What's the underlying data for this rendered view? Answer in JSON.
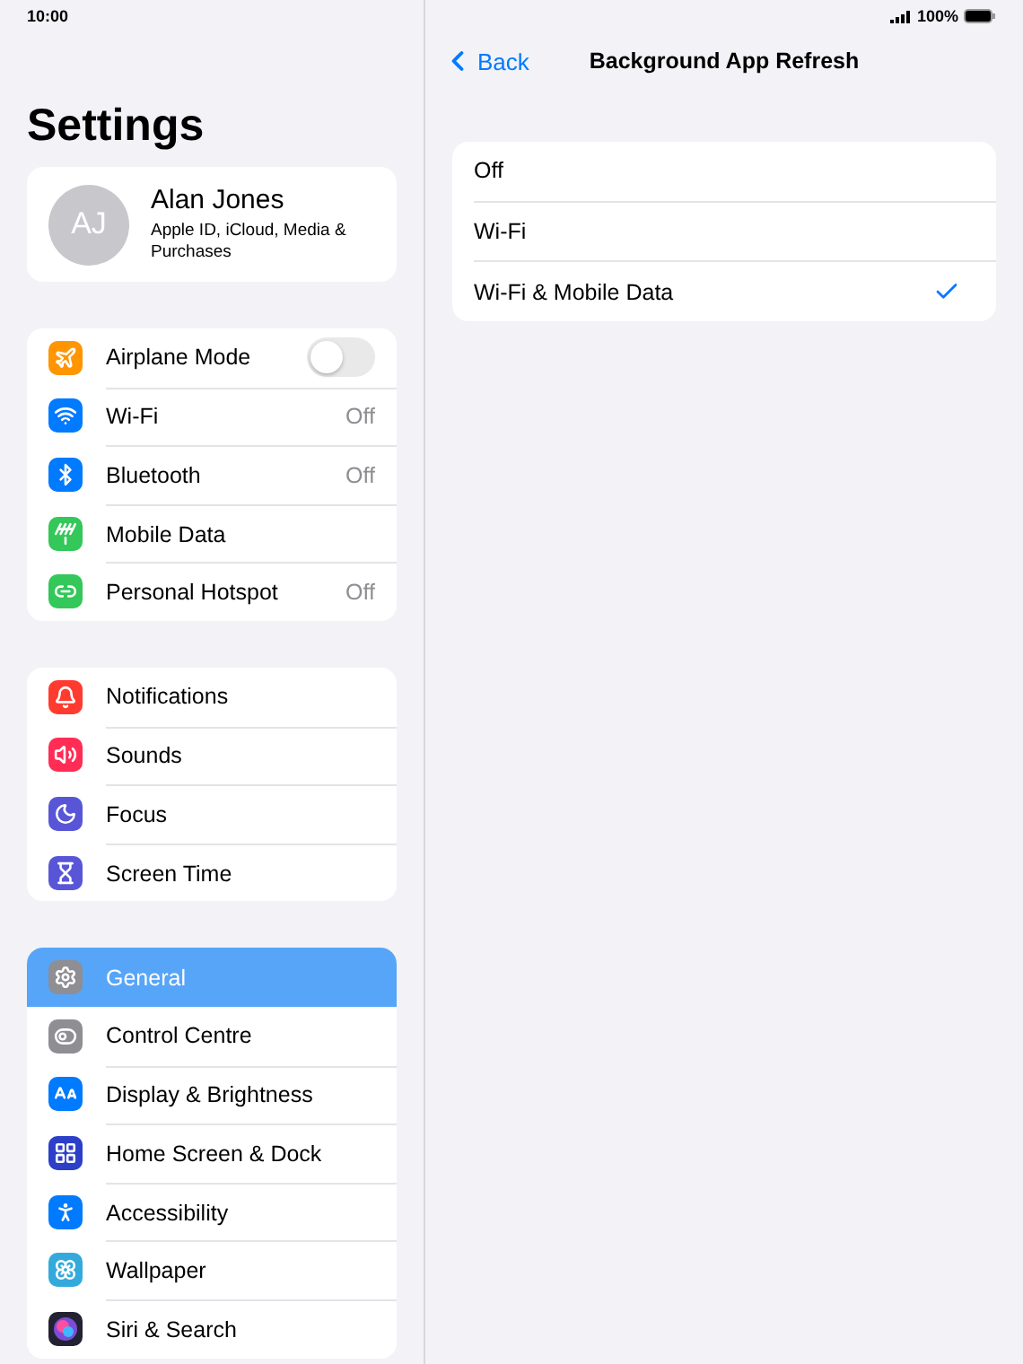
{
  "status_bar": {
    "time": "10:00",
    "battery": "100%"
  },
  "sidebar": {
    "title": "Settings",
    "profile": {
      "initials": "AJ",
      "name": "Alan Jones",
      "subtitle": "Apple ID, iCloud, Media & Purchases"
    },
    "groups": [
      {
        "items": [
          {
            "label": "Airplane Mode",
            "kind": "toggle",
            "on": false,
            "selected": false,
            "color": "#ff9500"
          },
          {
            "label": "Wi-Fi",
            "kind": "value",
            "value": "Off",
            "selected": false,
            "color": "#007aff"
          },
          {
            "label": "Bluetooth",
            "kind": "value",
            "value": "Off",
            "selected": false,
            "color": "#007aff"
          },
          {
            "label": "Mobile Data",
            "kind": "plain",
            "selected": false,
            "color": "#34c759"
          },
          {
            "label": "Personal Hotspot",
            "kind": "value",
            "value": "Off",
            "selected": false,
            "color": "#34c759"
          }
        ]
      },
      {
        "items": [
          {
            "label": "Notifications",
            "kind": "plain",
            "selected": false,
            "color": "#ff3b30"
          },
          {
            "label": "Sounds",
            "kind": "plain",
            "selected": false,
            "color": "#ff2d55"
          },
          {
            "label": "Focus",
            "kind": "plain",
            "selected": false,
            "color": "#5856d6"
          },
          {
            "label": "Screen Time",
            "kind": "plain",
            "selected": false,
            "color": "#5856d6"
          }
        ]
      },
      {
        "items": [
          {
            "label": "General",
            "kind": "plain",
            "selected": true,
            "color": "#8e8e93"
          },
          {
            "label": "Control Centre",
            "kind": "plain",
            "selected": false,
            "color": "#8e8e93"
          },
          {
            "label": "Display & Brightness",
            "kind": "plain",
            "selected": false,
            "color": "#007aff"
          },
          {
            "label": "Home Screen & Dock",
            "kind": "plain",
            "selected": false,
            "color": "#2c3fc9"
          },
          {
            "label": "Accessibility",
            "kind": "plain",
            "selected": false,
            "color": "#007aff"
          },
          {
            "label": "Wallpaper",
            "kind": "plain",
            "selected": false,
            "color": "#34aadc"
          },
          {
            "label": "Siri & Search",
            "kind": "plain",
            "selected": false,
            "color": "#222233"
          }
        ]
      }
    ]
  },
  "detail": {
    "back": "Back",
    "title": "Background App Refresh",
    "options": [
      {
        "label": "Off",
        "selected": false
      },
      {
        "label": "Wi-Fi",
        "selected": false
      },
      {
        "label": "Wi-Fi & Mobile Data",
        "selected": true
      }
    ]
  }
}
